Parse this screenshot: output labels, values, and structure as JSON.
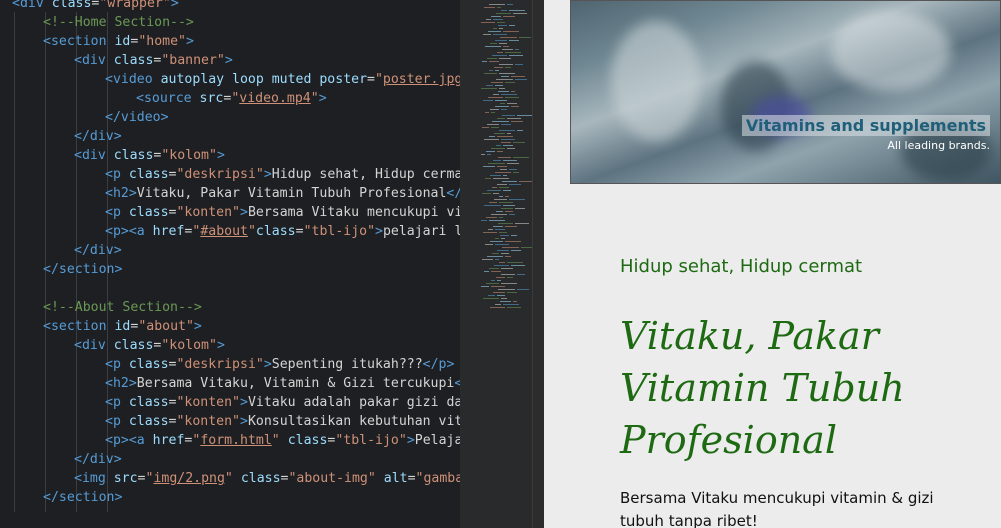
{
  "editor": {
    "lines": [
      {
        "i": 0,
        "parts": [
          [
            "tag",
            "<div "
          ],
          [
            "attr",
            "class"
          ],
          [
            "eq",
            "="
          ],
          [
            "val",
            "\"wrapper\""
          ],
          [
            "tag",
            ">"
          ]
        ]
      },
      {
        "i": 1,
        "parts": [
          [
            "cmt",
            "<!--Home Section-->"
          ]
        ]
      },
      {
        "i": 1,
        "parts": [
          [
            "tag",
            "<section "
          ],
          [
            "attr",
            "id"
          ],
          [
            "eq",
            "="
          ],
          [
            "val",
            "\"home\""
          ],
          [
            "tag",
            ">"
          ]
        ]
      },
      {
        "i": 2,
        "parts": [
          [
            "tag",
            "<div "
          ],
          [
            "attr",
            "class"
          ],
          [
            "eq",
            "="
          ],
          [
            "val",
            "\"banner\""
          ],
          [
            "tag",
            ">"
          ]
        ]
      },
      {
        "i": 3,
        "parts": [
          [
            "tag",
            "<video "
          ],
          [
            "attr",
            "autoplay loop muted poster"
          ],
          [
            "eq",
            "="
          ],
          [
            "val",
            "\""
          ],
          [
            "link",
            "poster.jpg"
          ],
          [
            "val",
            "\""
          ]
        ]
      },
      {
        "i": 4,
        "parts": [
          [
            "tag",
            "<source "
          ],
          [
            "attr",
            "src"
          ],
          [
            "eq",
            "="
          ],
          [
            "val",
            "\""
          ],
          [
            "link",
            "video.mp4"
          ],
          [
            "val",
            "\""
          ],
          [
            "tag",
            ">"
          ]
        ]
      },
      {
        "i": 3,
        "parts": [
          [
            "tag",
            "</video>"
          ]
        ]
      },
      {
        "i": 2,
        "parts": [
          [
            "tag",
            "</div>"
          ]
        ]
      },
      {
        "i": 2,
        "parts": [
          [
            "tag",
            "<div "
          ],
          [
            "attr",
            "class"
          ],
          [
            "eq",
            "="
          ],
          [
            "val",
            "\"kolom\""
          ],
          [
            "tag",
            ">"
          ]
        ]
      },
      {
        "i": 3,
        "parts": [
          [
            "tag",
            "<p "
          ],
          [
            "attr",
            "class"
          ],
          [
            "eq",
            "="
          ],
          [
            "val",
            "\"deskripsi\""
          ],
          [
            "tag",
            ">"
          ],
          [
            "txt",
            "Hidup sehat, Hidup cermat"
          ]
        ]
      },
      {
        "i": 3,
        "parts": [
          [
            "tag",
            "<h2>"
          ],
          [
            "txt",
            "Vitaku, Pakar Vitamin Tubuh Profesional"
          ],
          [
            "tag",
            "</h"
          ]
        ]
      },
      {
        "i": 3,
        "parts": [
          [
            "tag",
            "<p "
          ],
          [
            "attr",
            "class"
          ],
          [
            "eq",
            "="
          ],
          [
            "val",
            "\"konten\""
          ],
          [
            "tag",
            ">"
          ],
          [
            "txt",
            "Bersama Vitaku mencukupi vita"
          ]
        ]
      },
      {
        "i": 3,
        "parts": [
          [
            "tag",
            "<p><a "
          ],
          [
            "attr",
            "href"
          ],
          [
            "eq",
            "="
          ],
          [
            "val",
            "\""
          ],
          [
            "link",
            "#about"
          ],
          [
            "val",
            "\""
          ],
          [
            "attr",
            "class"
          ],
          [
            "eq",
            "="
          ],
          [
            "val",
            "\"tbl-ijo\""
          ],
          [
            "tag",
            ">"
          ],
          [
            "txt",
            "pelajari lel"
          ]
        ]
      },
      {
        "i": 2,
        "parts": [
          [
            "tag",
            "</div>"
          ]
        ]
      },
      {
        "i": 1,
        "parts": [
          [
            "tag",
            "</section>"
          ]
        ]
      },
      {
        "i": 0,
        "parts": []
      },
      {
        "i": 1,
        "parts": [
          [
            "cmt",
            "<!--About Section-->"
          ]
        ]
      },
      {
        "i": 1,
        "parts": [
          [
            "tag",
            "<section "
          ],
          [
            "attr",
            "id"
          ],
          [
            "eq",
            "="
          ],
          [
            "val",
            "\"about\""
          ],
          [
            "tag",
            ">"
          ]
        ]
      },
      {
        "i": 2,
        "parts": [
          [
            "tag",
            "<div "
          ],
          [
            "attr",
            "class"
          ],
          [
            "eq",
            "="
          ],
          [
            "val",
            "\"kolom\""
          ],
          [
            "tag",
            ">"
          ]
        ]
      },
      {
        "i": 3,
        "parts": [
          [
            "tag",
            "<p "
          ],
          [
            "attr",
            "class"
          ],
          [
            "eq",
            "="
          ],
          [
            "val",
            "\"deskripsi\""
          ],
          [
            "tag",
            ">"
          ],
          [
            "txt",
            "Sepenting itukah???"
          ],
          [
            "tag",
            "</p>"
          ]
        ]
      },
      {
        "i": 3,
        "parts": [
          [
            "tag",
            "<h2>"
          ],
          [
            "txt",
            "Bersama Vitaku, Vitamin & Gizi tercukupi"
          ],
          [
            "tag",
            "</h"
          ]
        ]
      },
      {
        "i": 3,
        "parts": [
          [
            "tag",
            "<p "
          ],
          [
            "attr",
            "class"
          ],
          [
            "eq",
            "="
          ],
          [
            "val",
            "\"konten\""
          ],
          [
            "tag",
            ">"
          ],
          [
            "txt",
            "Vitaku adalah pakar gizi dan"
          ]
        ]
      },
      {
        "i": 3,
        "parts": [
          [
            "tag",
            "<p "
          ],
          [
            "attr",
            "class"
          ],
          [
            "eq",
            "="
          ],
          [
            "val",
            "\"konten\""
          ],
          [
            "tag",
            ">"
          ],
          [
            "txt",
            "Konsultasikan kebutuhan vitan"
          ]
        ]
      },
      {
        "i": 3,
        "parts": [
          [
            "tag",
            "<p><a "
          ],
          [
            "attr",
            "href"
          ],
          [
            "eq",
            "="
          ],
          [
            "val",
            "\""
          ],
          [
            "link",
            "form.html"
          ],
          [
            "val",
            "\""
          ],
          [
            "txt",
            " "
          ],
          [
            "attr",
            "class"
          ],
          [
            "eq",
            "="
          ],
          [
            "val",
            "\"tbl-ijo\""
          ],
          [
            "tag",
            ">"
          ],
          [
            "txt",
            "Pelajari"
          ]
        ]
      },
      {
        "i": 2,
        "parts": [
          [
            "tag",
            "</div>"
          ]
        ]
      },
      {
        "i": 2,
        "parts": [
          [
            "tag",
            "<img "
          ],
          [
            "attr",
            "src"
          ],
          [
            "eq",
            "="
          ],
          [
            "val",
            "\""
          ],
          [
            "link",
            "img/2.png"
          ],
          [
            "val",
            "\""
          ],
          [
            "txt",
            " "
          ],
          [
            "attr",
            "class"
          ],
          [
            "eq",
            "="
          ],
          [
            "val",
            "\"about-img\""
          ],
          [
            "txt",
            " "
          ],
          [
            "attr",
            "alt"
          ],
          [
            "eq",
            "="
          ],
          [
            "val",
            "\"gambar"
          ]
        ]
      },
      {
        "i": 1,
        "parts": [
          [
            "tag",
            "</section>"
          ]
        ]
      }
    ]
  },
  "preview": {
    "banner_caption": "Vitamins and supplements",
    "banner_subcaption": "All leading brands.",
    "deskripsi": "Hidup sehat, Hidup cermat",
    "judul": "Vitaku, Pakar Vitamin Tubuh Profesional",
    "konten": "Bersama Vitaku mencukupi vitamin & gizi tubuh tanpa ribet!"
  },
  "colors": {
    "tag": "#569cd6",
    "attr": "#9cdcfe",
    "value": "#ce9178",
    "comment": "#6a9955",
    "heading_green": "#1d6a12"
  }
}
